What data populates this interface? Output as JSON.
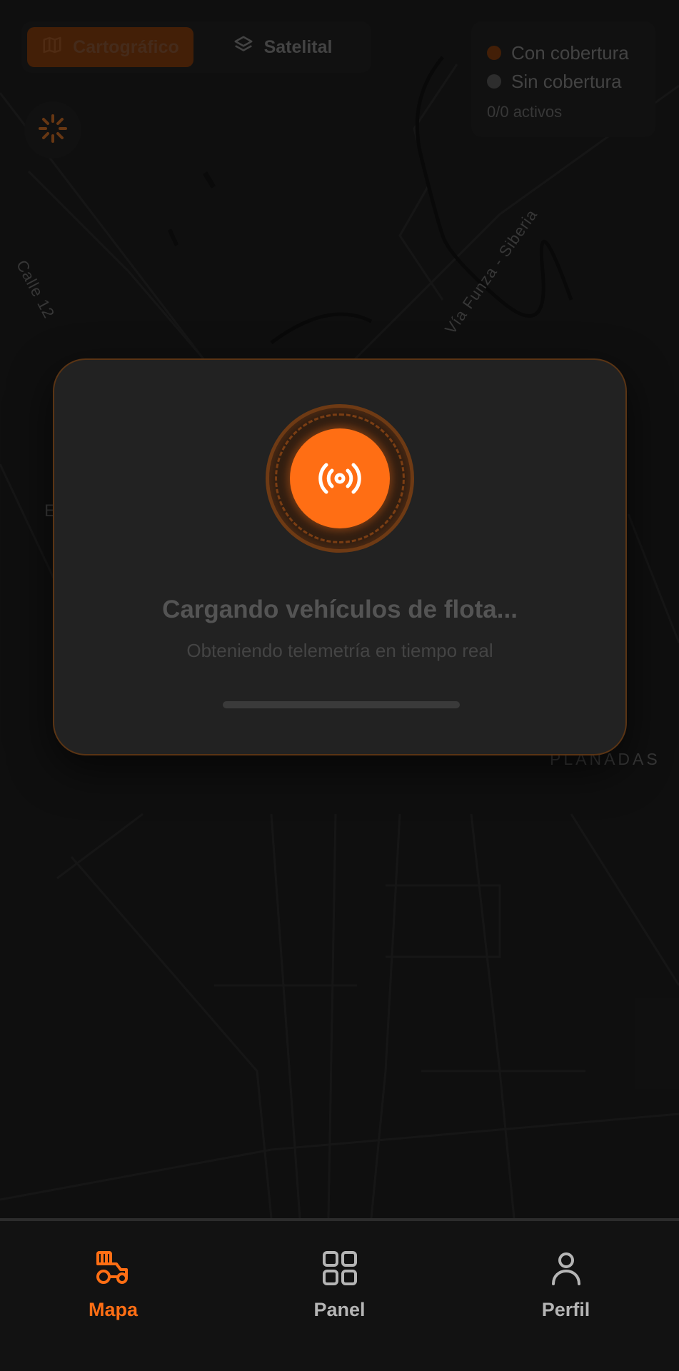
{
  "map": {
    "labels": {
      "calle": "Calle 12",
      "via": "Vía Funza - Siberia",
      "planadas": "PLANADAS",
      "partial": "E"
    }
  },
  "layer_toggle": {
    "options": [
      {
        "label": "Cartográfico",
        "icon": "map-icon",
        "active": true
      },
      {
        "label": "Satelital",
        "icon": "layers-icon",
        "active": false
      }
    ]
  },
  "coverage_legend": {
    "with_coverage": {
      "label": "Con cobertura",
      "color": "#5a2a0a"
    },
    "without_coverage": {
      "label": "Sin cobertura",
      "color": "#3c3c3c"
    },
    "active_count": "0/0 activos"
  },
  "loading_modal": {
    "icon": "broadcast-icon",
    "title": "Cargando vehículos de flota...",
    "subtitle": "Obteniendo telemetría en tiempo real",
    "progress": 0
  },
  "bottom_nav": {
    "items": [
      {
        "label": "Mapa",
        "icon": "tractor-icon",
        "active": true
      },
      {
        "label": "Panel",
        "icon": "grid-icon",
        "active": false
      },
      {
        "label": "Perfil",
        "icon": "user-icon",
        "active": false
      }
    ]
  },
  "colors": {
    "accent": "#ff6e14",
    "background": "#121212",
    "modal": "#222222"
  }
}
